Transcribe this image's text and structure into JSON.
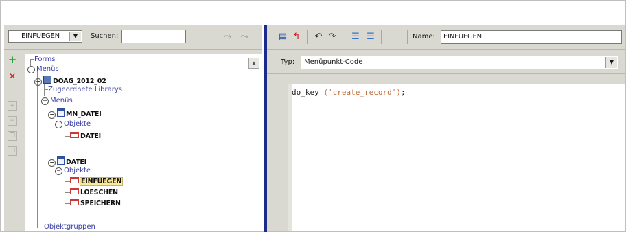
{
  "object_selector": {
    "value": "EINFUEGEN"
  },
  "search": {
    "label": "Suchen:",
    "value": ""
  },
  "tree": {
    "forms": "Forms",
    "menus_root": "Menüs",
    "module": "DOAG_2012_02",
    "attached_libraries": "Zugeordnete Librarys",
    "menus": "Menüs",
    "menu_mn_datei": "MN_DATEI",
    "objects_1": "Objekte",
    "item_datei": "DATEI",
    "menu_datei": "DATEI",
    "objects_2": "Objekte",
    "item_einfuegen": "EINFUEGEN",
    "item_loeschen": "LOESCHEN",
    "item_speichern": "SPEICHERN",
    "object_groups": "Objektgruppen"
  },
  "editor_toolbar": {
    "name_label": "Name:",
    "name_value": "EINFUEGEN"
  },
  "type_row": {
    "label": "Typ:",
    "value": "Menüpunkt-Code"
  },
  "code": {
    "fn": "do_key ",
    "arg": "('create_record')",
    "end": ";"
  },
  "colors": {
    "splitter": "#1c2a8c",
    "selection": "#fbe89a",
    "tree_text": "#3a40a8",
    "code_string": "#c06b3a"
  },
  "icons": [
    "chevron-down-icon",
    "search-forward-icon",
    "search-backward-icon",
    "add-icon",
    "delete-icon",
    "expand-icon",
    "collapse-icon",
    "copy-icon",
    "paste-icon",
    "compile-icon",
    "revert-icon",
    "undo-icon",
    "redo-icon",
    "indent-icon",
    "outdent-icon"
  ]
}
